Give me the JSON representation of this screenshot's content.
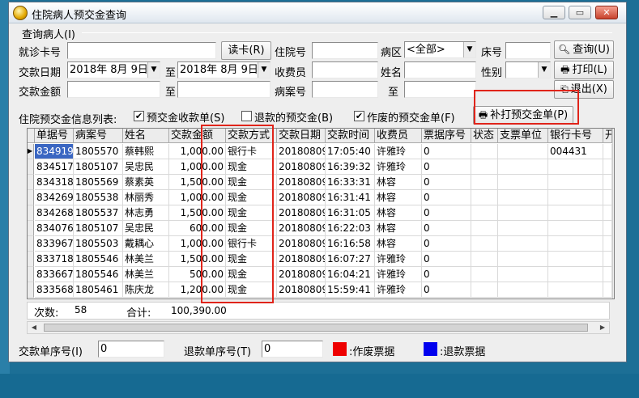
{
  "window": {
    "title": "住院病人预交金查询"
  },
  "query": {
    "group_title": "查询病人(I)",
    "card_label": "就诊卡号",
    "card_value": "",
    "read_card_button": "读卡(R)",
    "inpatient_no_label": "住院号",
    "inpatient_no_value": "",
    "ward_label": "病区",
    "ward_value": "<全部>",
    "bed_label": "床号",
    "bed_value": "",
    "date_label": "交款日期",
    "date_from": "2018年 8月 9日",
    "date_to_label": "至",
    "date_to": "2018年 8月 9日",
    "cashier_label": "收费员",
    "cashier_value": "",
    "name_label": "姓名",
    "name_value": "",
    "gender_label": "性别",
    "gender_value": "",
    "amount_label": "交款金额",
    "amount_from": "",
    "amount_to_label": "至",
    "amount_to": "",
    "case_no_label": "病案号",
    "case_no_value": "",
    "case_to_label": "至",
    "case_to": ""
  },
  "toolbar": {
    "query_button": "查询(U)",
    "print_button": "打印(L)",
    "exit_button": "退出(X)"
  },
  "list": {
    "label": "住院预交金信息列表:",
    "chk_receipt_label": "预交金收款单(S)",
    "chk_receipt_checked": "✔",
    "chk_refund_label": "退款的预交金(B)",
    "chk_refund_checked": "",
    "chk_void_label": "作废的预交金单(F)",
    "chk_void_checked": "✔",
    "reprint_button": "补打预交金单(P)"
  },
  "table": {
    "columns": [
      "单据号",
      "病案号",
      "姓名",
      "交款金额",
      "交款方式",
      "交款日期",
      "交款时间",
      "收费员",
      "票据序号",
      "状态",
      "支票单位",
      "银行卡号",
      "开"
    ],
    "rows": [
      [
        "834919",
        "1805570",
        "蔡韩熙",
        "1,000.00",
        "银行卡",
        "20180809",
        "17:05:40",
        "许雅玲",
        "0",
        "",
        "",
        "004431",
        ""
      ],
      [
        "834517",
        "1805107",
        "吴忠民",
        "1,000.00",
        "现金",
        "20180809",
        "16:39:32",
        "许雅玲",
        "0",
        "",
        "",
        "",
        ""
      ],
      [
        "834318",
        "1805569",
        "蔡素英",
        "1,500.00",
        "现金",
        "20180809",
        "16:33:31",
        "林容",
        "0",
        "",
        "",
        "",
        ""
      ],
      [
        "834269",
        "1805538",
        "林丽秀",
        "1,000.00",
        "现金",
        "20180809",
        "16:31:41",
        "林容",
        "0",
        "",
        "",
        "",
        ""
      ],
      [
        "834268",
        "1805537",
        "林志勇",
        "1,500.00",
        "现金",
        "20180809",
        "16:31:05",
        "林容",
        "0",
        "",
        "",
        "",
        ""
      ],
      [
        "834076",
        "1805107",
        "吴忠民",
        "600.00",
        "现金",
        "20180809",
        "16:22:03",
        "林容",
        "0",
        "",
        "",
        "",
        ""
      ],
      [
        "833967",
        "1805503",
        "戴耦心",
        "1,000.00",
        "银行卡",
        "20180809",
        "16:16:58",
        "林容",
        "0",
        "",
        "",
        "",
        ""
      ],
      [
        "833718",
        "1805546",
        "林美兰",
        "1,500.00",
        "现金",
        "20180809",
        "16:07:27",
        "许雅玲",
        "0",
        "",
        "",
        "",
        ""
      ],
      [
        "833667",
        "1805546",
        "林美兰",
        "500.00",
        "现金",
        "20180809",
        "16:04:21",
        "许雅玲",
        "0",
        "",
        "",
        "",
        ""
      ],
      [
        "833568",
        "1805461",
        "陈庆龙",
        "1,200.00",
        "现金",
        "20180809",
        "15:59:41",
        "许雅玲",
        "0",
        "",
        "",
        "",
        ""
      ]
    ],
    "footer_count_label": "次数:",
    "footer_count": "58",
    "footer_total_label": "合计:",
    "footer_total": "100,390.00"
  },
  "bottom": {
    "receipt_seq_label": "交款单序号(I)",
    "receipt_seq_value": "0",
    "refund_seq_label": "退款单序号(T)",
    "refund_seq_value": "0",
    "void_legend": ":作废票据",
    "void_color": "#ee0000",
    "refund_legend": ":退款票据",
    "refund_color": "#0000ee"
  }
}
